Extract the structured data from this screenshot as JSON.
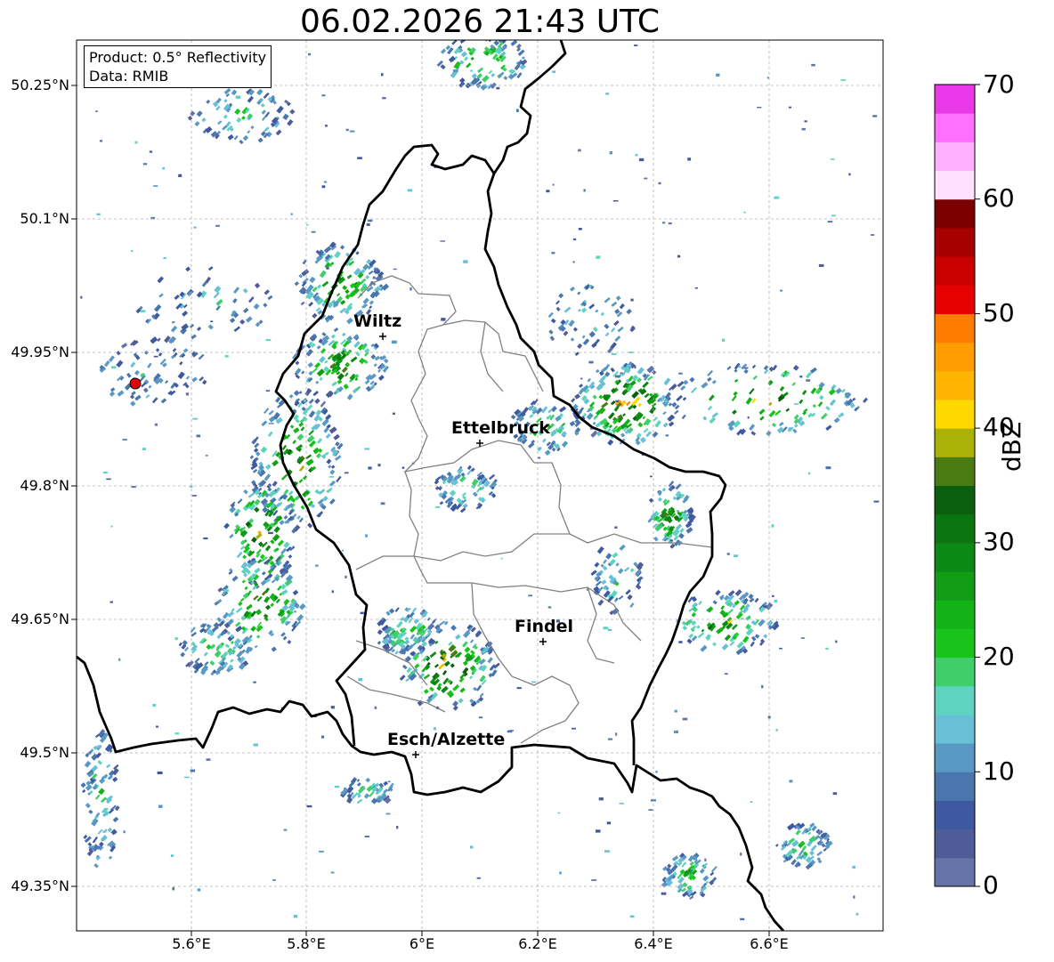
{
  "title": "06.02.2026 21:43 UTC",
  "info": {
    "product": "Product: 0.5° Reflectivity",
    "data_source": "Data: RMIB"
  },
  "cities": [
    {
      "name": "Wiltz"
    },
    {
      "name": "Ettelbruck"
    },
    {
      "name": "Findel"
    },
    {
      "name": "Esch/Alzette"
    }
  ],
  "lat_labels": [
    "50.25°N",
    "50.1°N",
    "49.95°N",
    "49.8°N",
    "49.65°N",
    "49.5°N",
    "49.35°N"
  ],
  "lon_labels": [
    "5.6°E",
    "5.8°E",
    "6°E",
    "6.2°E",
    "6.4°E",
    "6.6°E"
  ],
  "colorbar": {
    "label": "dBZ",
    "ticks": [
      "0",
      "10",
      "20",
      "30",
      "40",
      "50",
      "60",
      "70"
    ],
    "colors": [
      "#6474a8",
      "#4e5c98",
      "#3e59a0",
      "#4a76ad",
      "#5a98c4",
      "#68c0d6",
      "#5ed4c0",
      "#3ecf6a",
      "#18c41c",
      "#13b318",
      "#109c14",
      "#0c8814",
      "#0b7512",
      "#0b5e0e",
      "#4a7a12",
      "#aab208",
      "#ffd800",
      "#ffb400",
      "#ff9c00",
      "#ff7c00",
      "#e60000",
      "#c80000",
      "#a60000",
      "#7c0000",
      "#ffe0ff",
      "#ffb0ff",
      "#ff70ff",
      "#e838e8"
    ]
  },
  "radar_site_color": "#e00000"
}
